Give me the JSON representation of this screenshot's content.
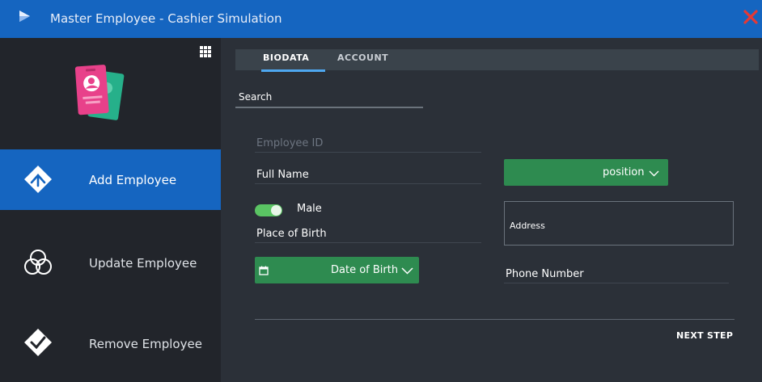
{
  "window": {
    "title": "Master Employee - Cashier Simulation",
    "accent": "#1565c0",
    "close_color": "#e53935"
  },
  "sidebar": {
    "menu_icon": "grid-menu-icon",
    "logo_icon": "id-cards-icon",
    "items": [
      {
        "label": "Add Employee",
        "icon": "add-employee-icon",
        "active": true
      },
      {
        "label": "Update Employee",
        "icon": "update-employee-icon",
        "active": false
      },
      {
        "label": "Remove Employee",
        "icon": "remove-employee-icon",
        "active": false
      }
    ]
  },
  "tabs": [
    {
      "label": "BIODATA",
      "active": true
    },
    {
      "label": "ACCOUNT",
      "active": false
    }
  ],
  "search": {
    "placeholder": "Search"
  },
  "form": {
    "employee_id": {
      "placeholder": "Employee ID",
      "value": ""
    },
    "full_name": {
      "placeholder": "Full Name"
    },
    "gender": {
      "label": "Male",
      "on": true
    },
    "place_of_birth": {
      "placeholder": "Place of Birth"
    },
    "date_of_birth": {
      "label": "Date of Birth",
      "icon": "calendar-icon"
    },
    "position": {
      "label": "position"
    },
    "address": {
      "placeholder": "Address"
    },
    "phone_number": {
      "placeholder": "Phone Number"
    },
    "button_color": "#2e8b50"
  },
  "actions": {
    "next_step": "NEXT STEP"
  }
}
